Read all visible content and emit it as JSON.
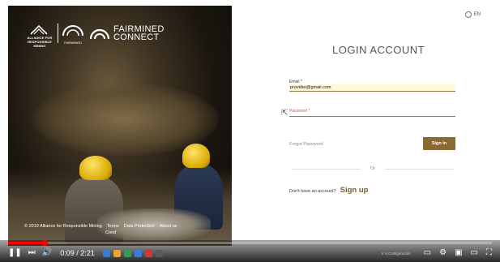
{
  "brand": {
    "alliance_text": "ALLIANCE FOR RESPONSIBLE MINING",
    "fairmined_text": "FAIRMINED",
    "product_name_line1": "FAIRMINED",
    "product_name_line2": "CONNECT"
  },
  "footer": {
    "copyright": "© 2019 Alliance for Responsible Mining",
    "link_terms": "Terms",
    "link_terms_line2": "Cond",
    "link_data": "Data Protection",
    "link_about": "About us"
  },
  "lang": {
    "label": "EN"
  },
  "login": {
    "title": "LOGIN ACCOUNT",
    "email_label": "Email *",
    "email_value": "provider@gmail.com",
    "password_label": "Password *",
    "forgot": "Forgot Password",
    "signin": "Sign In",
    "or": "Or",
    "no_account": "Don't have an account?",
    "signup": "Sign up"
  },
  "player": {
    "time": "0:09 / 2:21",
    "progress_fraction": 0.075,
    "system_text": "Ir a Configuración"
  },
  "colors": {
    "accent": "#8a6a32",
    "error": "#d9534f",
    "progress": "#ff0000"
  }
}
